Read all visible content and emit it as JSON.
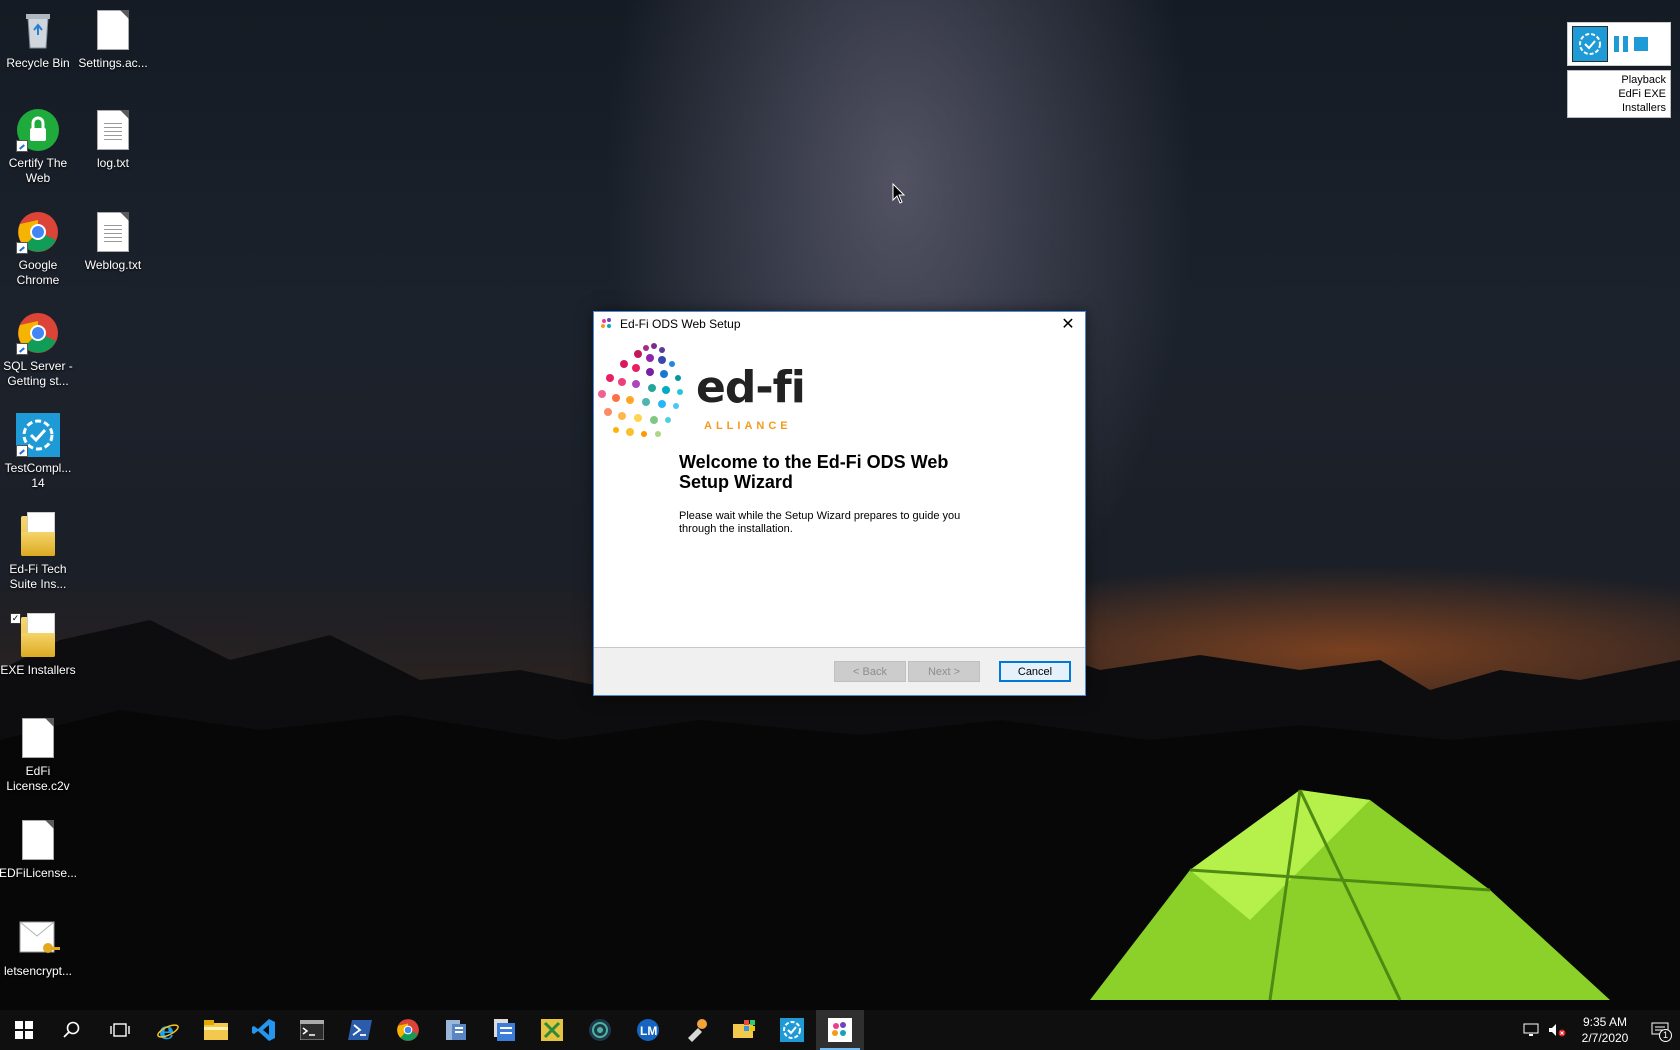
{
  "desktop": {
    "icons": [
      {
        "label": "Recycle Bin"
      },
      {
        "label": "Settings.ac..."
      },
      {
        "label": "Certify The Web"
      },
      {
        "label": "log.txt"
      },
      {
        "label": "Google Chrome"
      },
      {
        "label": "Weblog.txt"
      },
      {
        "label": "SQL Server - Getting st..."
      },
      {
        "label": "TestCompl... 14"
      },
      {
        "label": "Ed-Fi Tech Suite Ins..."
      },
      {
        "label": "EXE Installers"
      },
      {
        "label": "EdFi License.c2v"
      },
      {
        "label": "EDFiLicense..."
      },
      {
        "label": "letsencrypt..."
      }
    ]
  },
  "playback_widget": {
    "status": "Playback",
    "test_name": "EdFi EXE Installers"
  },
  "dialog": {
    "title": "Ed-Fi ODS Web Setup",
    "logo_text": "ed-fi",
    "logo_subtext": "ALLIANCE",
    "heading": "Welcome to the Ed-Fi ODS Web Setup Wizard",
    "body": "Please wait while the Setup Wizard prepares to guide you through the installation.",
    "buttons": {
      "back": "< Back",
      "next": "Next >",
      "cancel": "Cancel"
    }
  },
  "taskbar": {
    "apps": [
      "start-icon",
      "search-icon",
      "task-view-icon",
      "internet-explorer-icon",
      "file-explorer-icon",
      "vscode-icon",
      "command-prompt-icon",
      "powershell-icon",
      "chrome-icon",
      "server-manager-icon",
      "file-manager-icon",
      "network-tool-icon",
      "app-globe-icon",
      "license-manager-icon",
      "tool-icon",
      "windows-folder-icon",
      "testcomplete-icon",
      "edfi-setup-icon"
    ],
    "time": "9:35 AM",
    "date": "2/7/2020",
    "notification_count": "1"
  },
  "colors": {
    "accent": "#0078d7",
    "testcomplete": "#1e9bd7",
    "edfi_orange": "#f29b1d"
  }
}
